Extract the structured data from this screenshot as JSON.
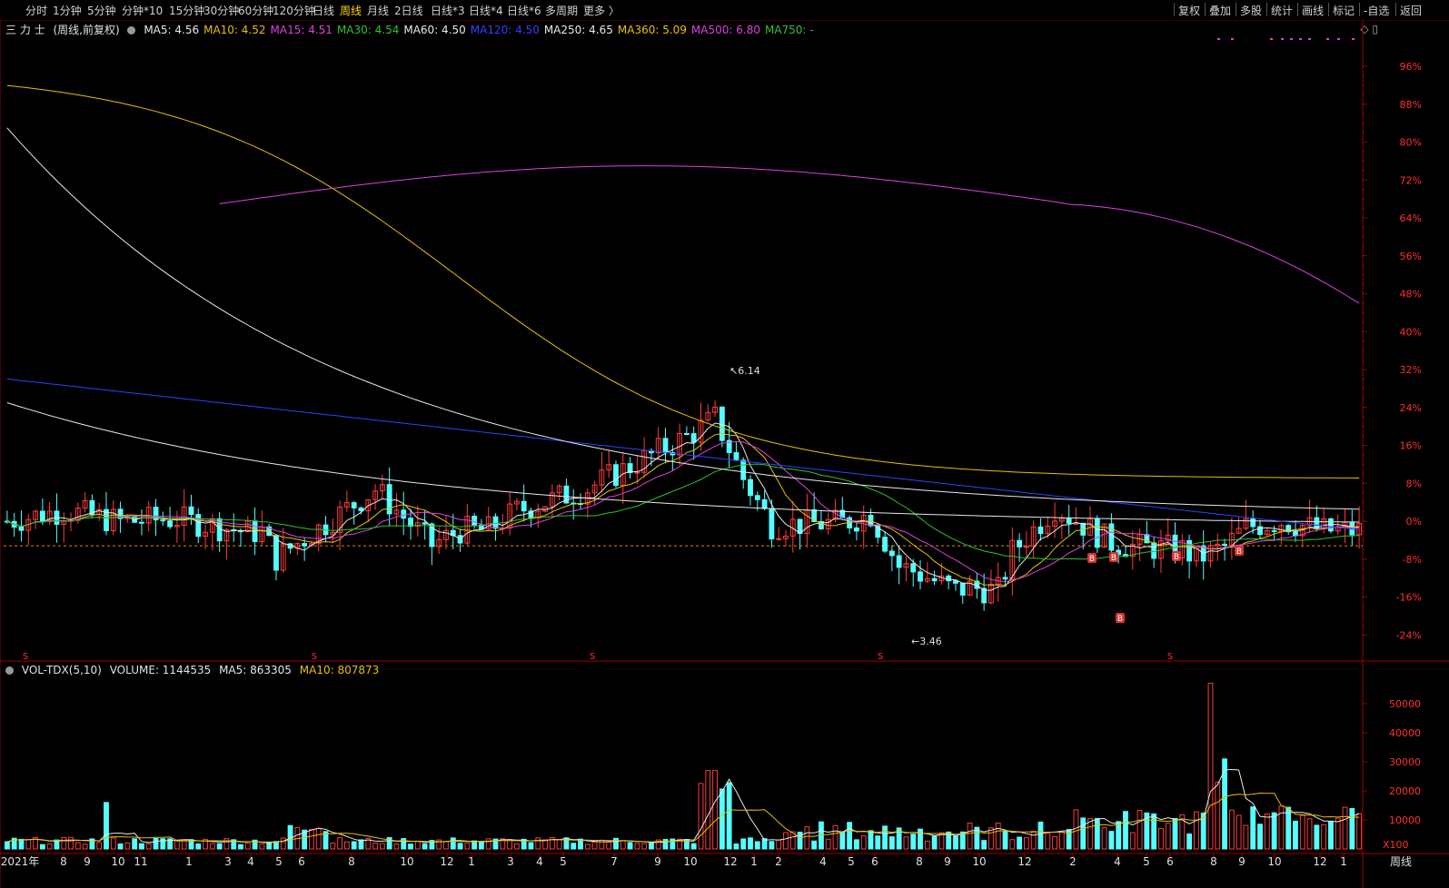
{
  "toolbar": {
    "left_items": [
      "分时",
      "1分钟",
      "5分钟",
      "分钟*10",
      "15分钟",
      "30分钟",
      "60分钟",
      "120分钟",
      "日线",
      "周线",
      "月线",
      "2日线",
      "日线*3",
      "日线*4",
      "日线*6",
      "多周期",
      "更多 〉"
    ],
    "active": "周线",
    "right_items": [
      "复权",
      "叠加",
      "多股",
      "统计",
      "画线",
      "标记",
      "-自选",
      "返回"
    ]
  },
  "header": {
    "stock_name": "三 力 士",
    "mode": "(周线,前复权)",
    "ma_items": [
      {
        "label": "MA5: 4.56",
        "color": "#e8e8e8"
      },
      {
        "label": "MA10: 4.52",
        "color": "#e8c000"
      },
      {
        "label": "MA15: 4.51",
        "color": "#e040e0"
      },
      {
        "label": "MA30: 4.54",
        "color": "#30c030"
      },
      {
        "label": "MA60: 4.50",
        "color": "#e8e8e8"
      },
      {
        "label": "MA120: 4.50",
        "color": "#3040ff"
      },
      {
        "label": "MA250: 4.65",
        "color": "#e8e8e8"
      },
      {
        "label": "MA360: 5.09",
        "color": "#e8c000"
      },
      {
        "label": "MA500: 6.80",
        "color": "#e040e0"
      },
      {
        "label": "MA750: -",
        "color": "#30c030"
      }
    ]
  },
  "volume_header": {
    "indicator": "VOL-TDX(5,10)",
    "volume": "VOLUME: 1144535",
    "ma5": "MA5: 863305",
    "ma10": "MA10: 807873",
    "ma5_color": "#e8e8e8",
    "ma10_color": "#e8c000"
  },
  "colors": {
    "up": "#ff3b3b",
    "down": "#54ffff",
    "axis": "#a00000",
    "grid": "#5a0000"
  },
  "chart_data": [
    {
      "type": "candlestick",
      "title": "三 力 士 (周线,前复权)",
      "yaxis_percent_ticks": [
        "96%",
        "88%",
        "80%",
        "72%",
        "64%",
        "56%",
        "48%",
        "40%",
        "32%",
        "24%",
        "16%",
        "8%",
        "0%",
        "-8%",
        "-16%",
        "-24%"
      ],
      "ylim_percent": [
        -24,
        96
      ],
      "base_line_percent": -5.2,
      "annotations": {
        "high": "6.14",
        "low": "3.46"
      },
      "signal_markers": [
        "B",
        "B",
        "B",
        "B",
        "B",
        "B"
      ],
      "s_markers": [
        "S",
        "S",
        "S",
        "S",
        "S"
      ]
    },
    {
      "type": "bar",
      "title": "VOL-TDX(5,10)",
      "yaxis_ticks": [
        "50000",
        "40000",
        "30000",
        "20000",
        "10000"
      ],
      "unit": "X100",
      "ylim": [
        0,
        58000
      ]
    }
  ],
  "xaxis": {
    "labels": [
      "2021年",
      "8",
      "9",
      "10",
      "11",
      "1",
      "3",
      "4",
      "5",
      "6",
      "8",
      "10",
      "12",
      "1",
      "3",
      "4",
      "5",
      "7",
      "9",
      "10",
      "12",
      "1",
      "2",
      "4",
      "5",
      "6",
      "8",
      "9",
      "10",
      "12",
      "2",
      "4",
      "5",
      "6",
      "8",
      "9",
      "10",
      "12",
      "1"
    ],
    "period": "周线"
  }
}
